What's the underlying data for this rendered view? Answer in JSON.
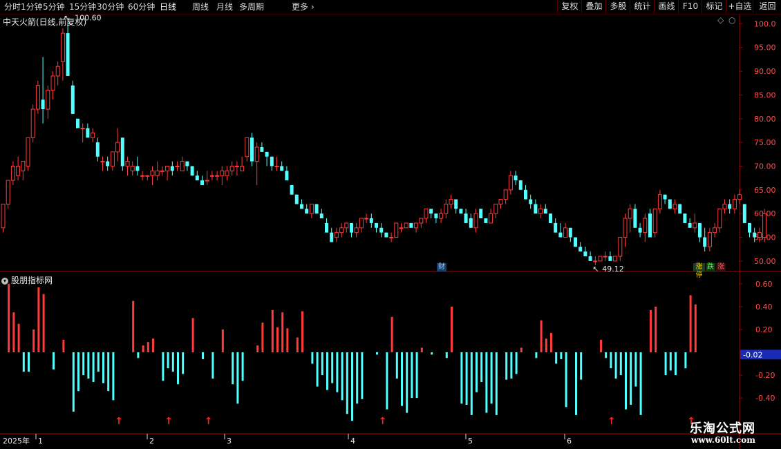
{
  "toolbar": {
    "periods": [
      "分时",
      "1分钟",
      "5分钟",
      "15分钟",
      "30分钟",
      "60分钟",
      "日线",
      "周线",
      "月线",
      "多周期",
      "更多"
    ],
    "active_period": "日线",
    "right_buttons": [
      "复权",
      "叠加",
      "多股",
      "统计",
      "画线",
      "F10",
      "标记",
      "+自选",
      "返回"
    ]
  },
  "main_panel": {
    "title": "中天火箭(日线,前复权)",
    "high_label": "100.60",
    "low_label": "49.12",
    "caibao_label": "财",
    "badges": [
      "涨停",
      "跌",
      "涨"
    ]
  },
  "sub_panel": {
    "title": "股朋指标网",
    "current_value": "-0.02"
  },
  "time_axis": {
    "year_label": "2025年",
    "months": [
      "1",
      "2",
      "3",
      "4",
      "5",
      "6"
    ]
  },
  "watermark": {
    "line1": "乐淘公式网",
    "line2": "www.60lt.com"
  },
  "colors": {
    "up": "#ff3c3c",
    "down": "#54ffff",
    "axis": "#b00000",
    "grid": "#5a0000",
    "label_value_box": "#1b2bb3"
  },
  "chart_data": {
    "type": "candlestick",
    "y_axis_main": {
      "ticks": [
        "100.0",
        "95.00",
        "90.00",
        "85.00",
        "80.00",
        "75.00",
        "70.00",
        "65.00",
        "60.00",
        "55.00",
        "50.00"
      ],
      "ylim": [
        47.8,
        101.8
      ]
    },
    "y_axis_sub": {
      "ticks": [
        "0.60",
        "0.40",
        "0.20",
        "-0.20",
        "-0.40"
      ],
      "ylim": [
        -0.69,
        0.69
      ]
    },
    "candles": [
      [
        57,
        62,
        56,
        62
      ],
      [
        62,
        67,
        61,
        67
      ],
      [
        67,
        71,
        66,
        70
      ],
      [
        68,
        72,
        67,
        70
      ],
      [
        69,
        71,
        67,
        71
      ],
      [
        70,
        76,
        69,
        76
      ],
      [
        76,
        83,
        75,
        82
      ],
      [
        82,
        88,
        81,
        87
      ],
      [
        84,
        93,
        79,
        82
      ],
      [
        82,
        87,
        80,
        86
      ],
      [
        86,
        90,
        84,
        89
      ],
      [
        89,
        92,
        87,
        91
      ],
      [
        92,
        99,
        88,
        98
      ],
      [
        98,
        100.6,
        89,
        89
      ],
      [
        87,
        88,
        81,
        81
      ],
      [
        80,
        79.5,
        78,
        78
      ],
      [
        78,
        79,
        75,
        78
      ],
      [
        78,
        79,
        76,
        76
      ],
      [
        76,
        78,
        75,
        77
      ],
      [
        75,
        76,
        71,
        72
      ],
      [
        71,
        72,
        69,
        71
      ],
      [
        71,
        72,
        69,
        70
      ],
      [
        70,
        73,
        69,
        73
      ],
      [
        73,
        78,
        71,
        75
      ],
      [
        76,
        76,
        69,
        70
      ],
      [
        70,
        72,
        68,
        71
      ],
      [
        69,
        71,
        68,
        70
      ],
      [
        70,
        72,
        68,
        69
      ],
      [
        68,
        69,
        67,
        68
      ],
      [
        68,
        68,
        67,
        68
      ],
      [
        68,
        70,
        66,
        69
      ],
      [
        68,
        71,
        67,
        69
      ],
      [
        69,
        70,
        68,
        69
      ],
      [
        69,
        70,
        67,
        70
      ],
      [
        70,
        71,
        68,
        69
      ],
      [
        70,
        71,
        69,
        70
      ],
      [
        69,
        72,
        69,
        71
      ],
      [
        71,
        71,
        69,
        70
      ],
      [
        70,
        70,
        68,
        68
      ],
      [
        68,
        69,
        67,
        67
      ],
      [
        67,
        68,
        66,
        66
      ],
      [
        67,
        69,
        66,
        67
      ],
      [
        68,
        69,
        67,
        68
      ],
      [
        68,
        69,
        67,
        68
      ],
      [
        68,
        70,
        66,
        69
      ],
      [
        68,
        70,
        67,
        69
      ],
      [
        69,
        71,
        68,
        70
      ],
      [
        70,
        71,
        68,
        70
      ],
      [
        69,
        72,
        69,
        70
      ],
      [
        72,
        75,
        71,
        76
      ],
      [
        76,
        77,
        70,
        71
      ],
      [
        71,
        75,
        66,
        74
      ],
      [
        74,
        75,
        73,
        73
      ],
      [
        73,
        73,
        70,
        72
      ],
      [
        72,
        72,
        69,
        70
      ],
      [
        70,
        72,
        69,
        70
      ],
      [
        70,
        71,
        69,
        69
      ],
      [
        69,
        70,
        67,
        67
      ],
      [
        66,
        66,
        64,
        64
      ],
      [
        64,
        64,
        62,
        62
      ],
      [
        62,
        63,
        61,
        61
      ],
      [
        61,
        62,
        60,
        60
      ],
      [
        60,
        62,
        59,
        62
      ],
      [
        62,
        62,
        60,
        60
      ],
      [
        60,
        61,
        59,
        59
      ],
      [
        58,
        59,
        56,
        56
      ],
      [
        56,
        57,
        54,
        54
      ],
      [
        55,
        57,
        54,
        56
      ],
      [
        56,
        58,
        55,
        57
      ],
      [
        57,
        58,
        56,
        58
      ],
      [
        58,
        58,
        55,
        56
      ],
      [
        56,
        58,
        55,
        57
      ],
      [
        57,
        59,
        56,
        59
      ],
      [
        59,
        60,
        58,
        59
      ],
      [
        59,
        60,
        57,
        58
      ],
      [
        58,
        58,
        56,
        57
      ],
      [
        57,
        58,
        55,
        56
      ],
      [
        56,
        56,
        55,
        55
      ],
      [
        55,
        56,
        54,
        55
      ],
      [
        55,
        58,
        55,
        58
      ],
      [
        57,
        58,
        56,
        57
      ],
      [
        57,
        58,
        57,
        58
      ],
      [
        58,
        58,
        57,
        57
      ],
      [
        57,
        58,
        56,
        58
      ],
      [
        58,
        59,
        57,
        59
      ],
      [
        59,
        61,
        58,
        61
      ],
      [
        61,
        61,
        59,
        60
      ],
      [
        60,
        60,
        58,
        59
      ],
      [
        59,
        61,
        58,
        60
      ],
      [
        60,
        63,
        59,
        62
      ],
      [
        62,
        64,
        61,
        63
      ],
      [
        63,
        63,
        60,
        61
      ],
      [
        61,
        61,
        60,
        60
      ],
      [
        60,
        61,
        58,
        58
      ],
      [
        59,
        60,
        57,
        57
      ],
      [
        57,
        61,
        56,
        60
      ],
      [
        61,
        61,
        59,
        59
      ],
      [
        59,
        59,
        58,
        58
      ],
      [
        58,
        61,
        58,
        60
      ],
      [
        60,
        62,
        59,
        62
      ],
      [
        62,
        63,
        61,
        63
      ],
      [
        63,
        65,
        62,
        65
      ],
      [
        65,
        69,
        64,
        68
      ],
      [
        68,
        69,
        66,
        67
      ],
      [
        67,
        67,
        65,
        65
      ],
      [
        65,
        66,
        63,
        63
      ],
      [
        63,
        64,
        61,
        62
      ],
      [
        62,
        63,
        60,
        60
      ],
      [
        60,
        62,
        59,
        61
      ],
      [
        61,
        62,
        60,
        60
      ],
      [
        60,
        60,
        58,
        58
      ],
      [
        58,
        59,
        56,
        56
      ],
      [
        56,
        58,
        55,
        55
      ],
      [
        55,
        58,
        55,
        57
      ],
      [
        57,
        57,
        54,
        55
      ],
      [
        55,
        55,
        53,
        53
      ],
      [
        53,
        54,
        52,
        52
      ],
      [
        52,
        53,
        51,
        51
      ],
      [
        51,
        52,
        50,
        50
      ],
      [
        50,
        51,
        49.12,
        50
      ],
      [
        50,
        51,
        50,
        51
      ],
      [
        51,
        52,
        50,
        51
      ],
      [
        51,
        52,
        50,
        50
      ],
      [
        50,
        51,
        50,
        51
      ],
      [
        51,
        55,
        50,
        55
      ],
      [
        55,
        60,
        53,
        59
      ],
      [
        59,
        62,
        56,
        61
      ],
      [
        61,
        62,
        57,
        57
      ],
      [
        57,
        58,
        55,
        56
      ],
      [
        56,
        60,
        54,
        59
      ],
      [
        60,
        61,
        55,
        55
      ],
      [
        56,
        61,
        55,
        61
      ],
      [
        61,
        65,
        60,
        64
      ],
      [
        64,
        64,
        62,
        63
      ],
      [
        63,
        63,
        61,
        61
      ],
      [
        61,
        63,
        60,
        62
      ],
      [
        62,
        62,
        60,
        60
      ],
      [
        60,
        60,
        58,
        58
      ],
      [
        58,
        59,
        57,
        57
      ],
      [
        57,
        60,
        56,
        58
      ],
      [
        58,
        58,
        54,
        55
      ],
      [
        55,
        57,
        52,
        53
      ],
      [
        53,
        57,
        52,
        56
      ],
      [
        56,
        58,
        55,
        57
      ],
      [
        57,
        61,
        56,
        61
      ],
      [
        61,
        63,
        60,
        62
      ],
      [
        62,
        63,
        60,
        61
      ],
      [
        61,
        64,
        60,
        63
      ],
      [
        63,
        65,
        62,
        64
      ],
      [
        62,
        62,
        58,
        58
      ],
      [
        58,
        58,
        55,
        56
      ],
      [
        56,
        57,
        54,
        55
      ],
      [
        55,
        57,
        54,
        56
      ],
      [
        55,
        61,
        54,
        60
      ]
    ],
    "indicator": [
      0.0,
      0.6,
      0.35,
      0.25,
      -0.17,
      -0.17,
      0.2,
      0.57,
      0.51,
      0.0,
      -0.15,
      0.0,
      0.11,
      0.0,
      -0.52,
      -0.34,
      -0.2,
      -0.23,
      -0.26,
      -0.17,
      -0.27,
      -0.34,
      -0.42,
      0.0,
      0.0,
      0.0,
      0.45,
      -0.05,
      0.06,
      0.09,
      0.12,
      0.0,
      -0.25,
      -0.14,
      -0.17,
      -0.28,
      -0.19,
      0.0,
      0.3,
      0.0,
      -0.06,
      0.0,
      -0.23,
      0.0,
      0.2,
      0.0,
      -0.28,
      -0.45,
      -0.25,
      0.0,
      0.0,
      0.06,
      0.26,
      0.0,
      0.37,
      0.22,
      0.35,
      0.21,
      0.0,
      0.13,
      0.36,
      0.0,
      -0.1,
      -0.3,
      -0.2,
      -0.33,
      -0.27,
      -0.35,
      -0.42,
      -0.54,
      -0.6,
      -0.45,
      -0.41,
      0.0,
      0.0,
      -0.02,
      0.0,
      -0.5,
      0.31,
      -0.23,
      -0.47,
      -0.53,
      -0.4,
      -0.4,
      0.04,
      0.0,
      -0.02,
      0.0,
      0.0,
      -0.05,
      0.4,
      0.0,
      -0.45,
      -0.46,
      -0.55,
      -0.35,
      -0.26,
      -0.53,
      -0.45,
      -0.55,
      0.0,
      -0.24,
      -0.23,
      -0.19,
      0.04,
      0.0,
      0.0,
      -0.05,
      0.28,
      0.12,
      0.17,
      -0.1,
      -0.06,
      -0.48,
      0.0,
      -0.55,
      -0.24,
      0.0,
      0.0,
      0.0,
      0.11,
      -0.05,
      -0.14,
      -0.23,
      -0.2,
      -0.5,
      -0.46,
      -0.3,
      -0.55,
      0.0,
      0.37,
      0.4,
      0.0,
      -0.2,
      -0.16,
      -0.2,
      0.0,
      -0.14,
      0.5,
      0.42
    ],
    "arrows_at": [
      23,
      33,
      41,
      76,
      122,
      138
    ]
  }
}
